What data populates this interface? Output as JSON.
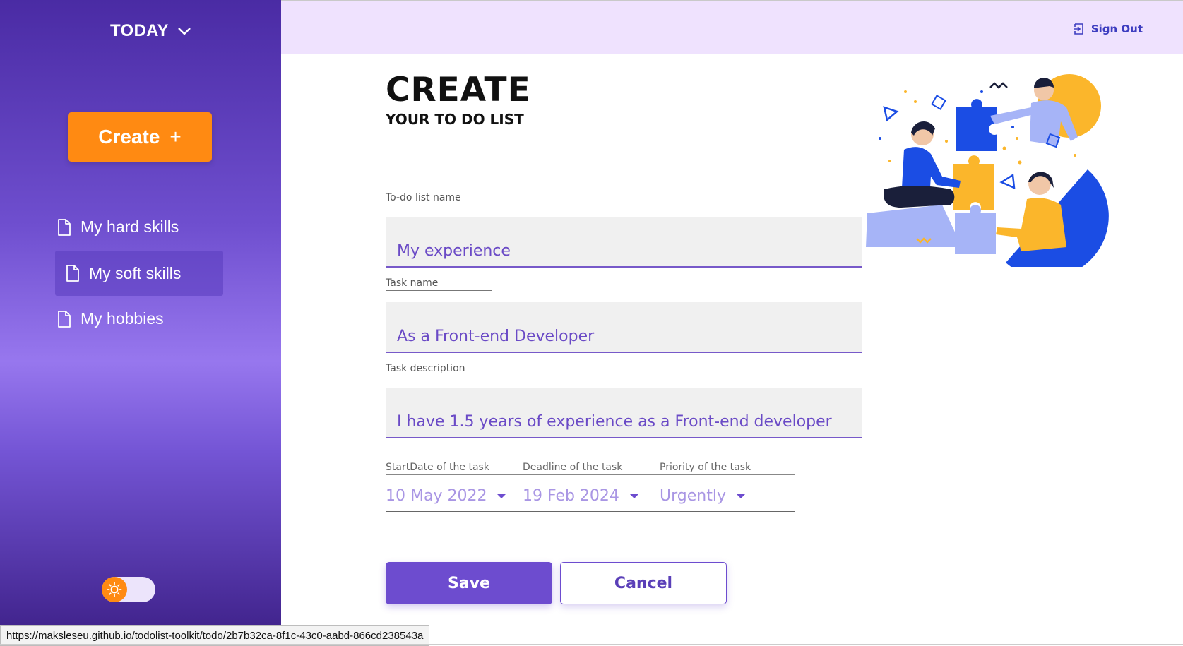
{
  "sidebar": {
    "today_label": "TODAY",
    "create_label": "Create",
    "create_plus": "+",
    "items": [
      {
        "label": "My hard skills"
      },
      {
        "label": "My soft skills"
      },
      {
        "label": "My hobbies"
      }
    ]
  },
  "header": {
    "signout_label": "Sign Out"
  },
  "main": {
    "title": "CREATE",
    "subtitle": "YOUR TO DO LIST",
    "fields": {
      "list_name": {
        "label": "To-do list name",
        "value": "My experience"
      },
      "task_name": {
        "label": "Task name",
        "value": "As a Front-end Developer"
      },
      "task_description": {
        "label": "Task description",
        "value": "I have 1.5 years of experience as a Front-end developer"
      }
    },
    "start_date": {
      "label": "StartDate of the task",
      "value": "10 May 2022"
    },
    "deadline": {
      "label": "Deadline of the task",
      "value": "19 Feb 2024"
    },
    "priority": {
      "label": "Priority of the task",
      "value": "Urgently"
    },
    "save_label": "Save",
    "cancel_label": "Cancel"
  },
  "statusbar": {
    "url": "https://maksleseu.github.io/todolist-toolkit/todo/2b7b32ca-8f1c-43c0-aabd-866cd238543a"
  },
  "colors": {
    "accent": "#6d4ccf",
    "create": "#ff8a12",
    "header_bg": "#efe2fe"
  }
}
